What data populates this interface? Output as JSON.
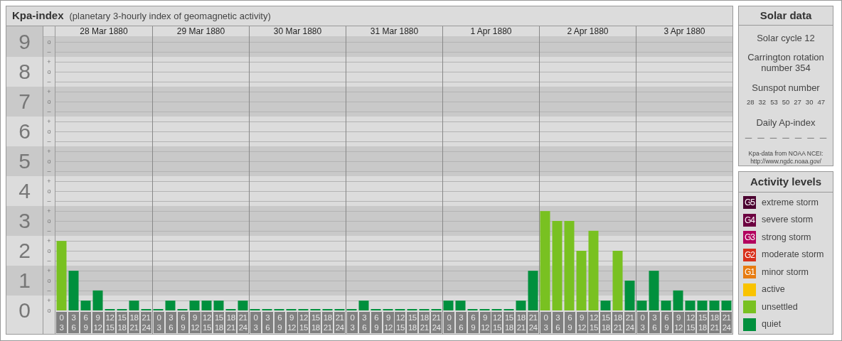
{
  "header": {
    "title": "Kpa-index",
    "subtitle": "(planetary 3-hourly index of geomagnetic activity)"
  },
  "kp_scale": [
    {
      "marks": [
        "o",
        "–"
      ]
    },
    {
      "marks": [
        "+",
        "o",
        "–"
      ]
    },
    {
      "marks": [
        "+",
        "o",
        "–"
      ]
    },
    {
      "marks": [
        "+",
        "o",
        "–"
      ]
    },
    {
      "marks": [
        "+",
        "o",
        "–"
      ]
    },
    {
      "marks": [
        "+",
        "o",
        "–"
      ]
    },
    {
      "marks": [
        "+",
        "o",
        "–"
      ]
    },
    {
      "marks": [
        "+",
        "o",
        "–"
      ]
    },
    {
      "marks": [
        "+",
        "o",
        "–"
      ]
    },
    {
      "marks": [
        "+",
        "o"
      ]
    }
  ],
  "days": [
    {
      "date": "28 Mar 1880",
      "slots": [
        [
          "0",
          "3"
        ],
        [
          "3",
          "6"
        ],
        [
          "6",
          "9"
        ],
        [
          "9",
          "12"
        ],
        [
          "12",
          "15"
        ],
        [
          "15",
          "18"
        ],
        [
          "18",
          "21"
        ],
        [
          "21",
          "24"
        ]
      ]
    },
    {
      "date": "29 Mar 1880",
      "slots": [
        [
          "0",
          "3"
        ],
        [
          "3",
          "6"
        ],
        [
          "6",
          "9"
        ],
        [
          "9",
          "12"
        ],
        [
          "12",
          "15"
        ],
        [
          "15",
          "18"
        ],
        [
          "18",
          "21"
        ],
        [
          "21",
          "24"
        ]
      ]
    },
    {
      "date": "30 Mar 1880",
      "slots": [
        [
          "0",
          "3"
        ],
        [
          "3",
          "6"
        ],
        [
          "6",
          "9"
        ],
        [
          "9",
          "12"
        ],
        [
          "12",
          "15"
        ],
        [
          "15",
          "18"
        ],
        [
          "18",
          "21"
        ],
        [
          "21",
          "24"
        ]
      ]
    },
    {
      "date": "31 Mar 1880",
      "slots": [
        [
          "0",
          "3"
        ],
        [
          "3",
          "6"
        ],
        [
          "6",
          "9"
        ],
        [
          "9",
          "12"
        ],
        [
          "12",
          "15"
        ],
        [
          "15",
          "18"
        ],
        [
          "18",
          "21"
        ],
        [
          "21",
          "24"
        ]
      ]
    },
    {
      "date": "1 Apr 1880",
      "slots": [
        [
          "0",
          "3"
        ],
        [
          "3",
          "6"
        ],
        [
          "6",
          "9"
        ],
        [
          "9",
          "12"
        ],
        [
          "12",
          "15"
        ],
        [
          "15",
          "18"
        ],
        [
          "18",
          "21"
        ],
        [
          "21",
          "24"
        ]
      ]
    },
    {
      "date": "2 Apr 1880",
      "slots": [
        [
          "0",
          "3"
        ],
        [
          "3",
          "6"
        ],
        [
          "6",
          "9"
        ],
        [
          "9",
          "12"
        ],
        [
          "12",
          "15"
        ],
        [
          "15",
          "18"
        ],
        [
          "18",
          "21"
        ],
        [
          "21",
          "24"
        ]
      ]
    },
    {
      "date": "3 Apr 1880",
      "slots": [
        [
          "0",
          "3"
        ],
        [
          "3",
          "6"
        ],
        [
          "6",
          "9"
        ],
        [
          "9",
          "12"
        ],
        [
          "12",
          "15"
        ],
        [
          "15",
          "18"
        ],
        [
          "18",
          "21"
        ],
        [
          "21",
          "24"
        ]
      ]
    }
  ],
  "chart_data": {
    "type": "bar",
    "grid": true,
    "ylim": [
      0,
      9.19
    ],
    "bands": [
      {
        "axis": "y",
        "from": 0.5,
        "to": 1.5
      },
      {
        "axis": "y",
        "from": 2.5,
        "to": 3.5
      },
      {
        "axis": "y",
        "from": 4.5,
        "to": 5.5
      },
      {
        "axis": "y",
        "from": 6.5,
        "to": 7.5
      },
      {
        "axis": "y",
        "from": 8.5,
        "to": 9.19
      }
    ],
    "yticks": [
      {
        "value": 9,
        "label": "9"
      },
      {
        "value": 8,
        "label": "8"
      },
      {
        "value": 7,
        "label": "7"
      },
      {
        "value": 6,
        "label": "6"
      },
      {
        "value": 5,
        "label": "5"
      },
      {
        "value": 4,
        "label": "4"
      },
      {
        "value": 3,
        "label": "3"
      },
      {
        "value": 2,
        "label": "2"
      },
      {
        "value": 1,
        "label": "1"
      },
      {
        "value": 0,
        "label": "0"
      }
    ],
    "categories": [
      null,
      null,
      null,
      null,
      null,
      null,
      null,
      null,
      null,
      null,
      null,
      null,
      null,
      null,
      null,
      null,
      null,
      null,
      null,
      null,
      null,
      null,
      null,
      null,
      null,
      null,
      null,
      null,
      null,
      null,
      null,
      null,
      null,
      null,
      null,
      null,
      null,
      null,
      null,
      null,
      null,
      null,
      null,
      null,
      null,
      null,
      null,
      null,
      null,
      null,
      null,
      null,
      null,
      null,
      null,
      null
    ],
    "series": [
      {
        "values": [
          2.33,
          1.33,
          0.33,
          0.67,
          0,
          0,
          0.33,
          0,
          0,
          0.33,
          0,
          0.33,
          0.33,
          0.33,
          0,
          0.33,
          0,
          0,
          0,
          0,
          0,
          0,
          0,
          0,
          0,
          0.33,
          0,
          0,
          0,
          0,
          0,
          0,
          0.33,
          0.33,
          0,
          0,
          0,
          0,
          0.33,
          1.33,
          3.33,
          3,
          3,
          2,
          2.67,
          0.33,
          2,
          1,
          0.33,
          1.33,
          0.33,
          0.67,
          0.33,
          0.33,
          0.33,
          0.33
        ]
      }
    ]
  },
  "solar_data": {
    "title": "Solar data",
    "solar_cycle": "Solar cycle 12",
    "carrington_rotation": "Carrington rotation number 354",
    "sunspot": {
      "heading": "Sunspot number",
      "values": [
        "28",
        "32",
        "53",
        "50",
        "27",
        "30",
        "47"
      ]
    },
    "ap_index": {
      "heading": "Daily Ap-index",
      "values": [
        "—",
        "—",
        "—",
        "—",
        "—",
        "—",
        "—"
      ]
    },
    "source": "Kpa-data from NOAA NCEI: http://www.ngdc.noaa.gov/"
  },
  "activity_levels": {
    "title": "Activity levels",
    "items": [
      {
        "badge": "G5",
        "label": "extreme storm",
        "color": "#4b0030"
      },
      {
        "badge": "G4",
        "label": "severe storm",
        "color": "#6c0040"
      },
      {
        "badge": "G3",
        "label": "strong storm",
        "color": "#b2005e"
      },
      {
        "badge": "G2",
        "label": "moderate storm",
        "color": "#d8301c"
      },
      {
        "badge": "G1",
        "label": "minor storm",
        "color": "#e77c12"
      },
      {
        "label": "active",
        "color": "#f9c300"
      },
      {
        "label": "unsettled",
        "color": "#79c121"
      },
      {
        "label": "quiet",
        "color": "#00903d"
      }
    ]
  }
}
